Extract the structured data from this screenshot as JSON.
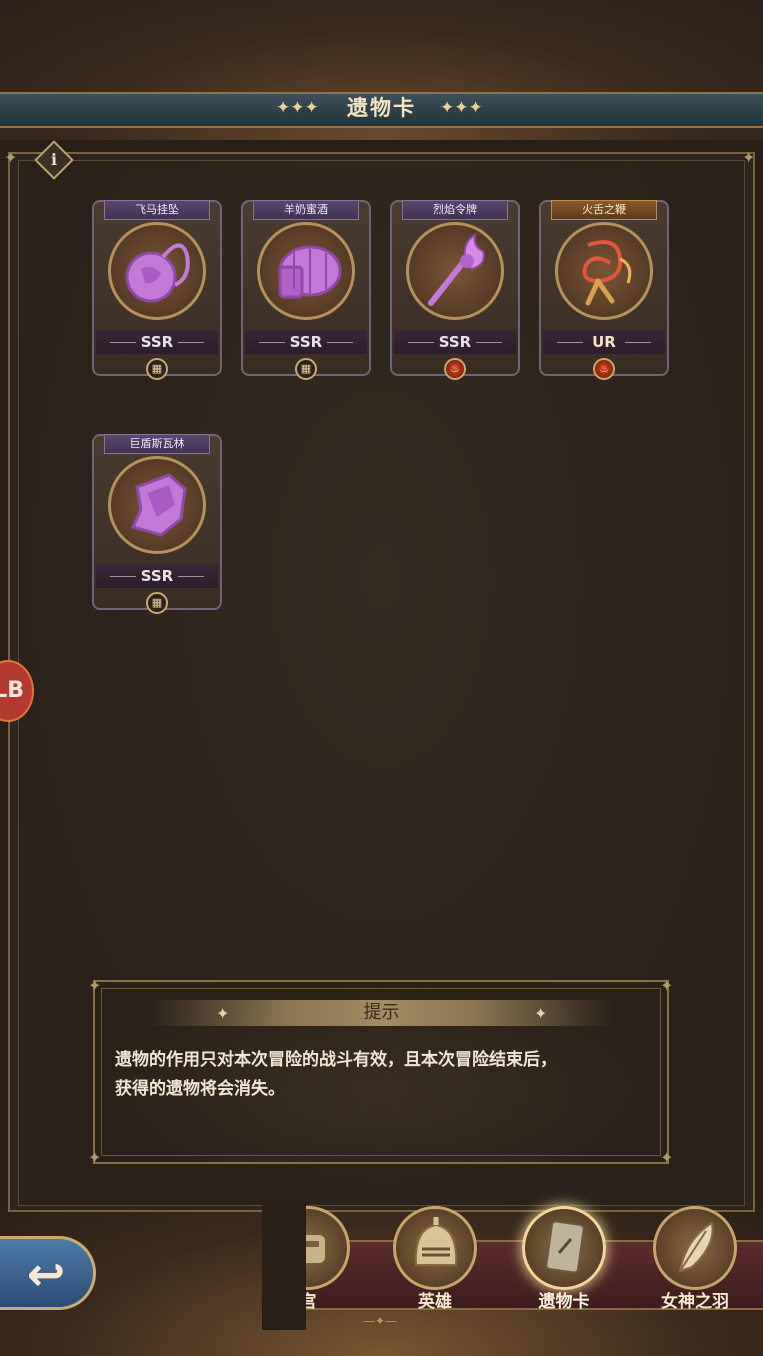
{
  "header": {
    "title": "遗物卡",
    "deco_left": "✦✦✦",
    "deco_right": "✦✦✦"
  },
  "info_button": {
    "glyph": "i"
  },
  "side_button": {
    "label": "LB"
  },
  "relics": [
    {
      "name": "飞马挂坠",
      "rarity": "SSR",
      "badge": "grid-icon",
      "color": "#c27ad8"
    },
    {
      "name": "羊奶蜜酒",
      "rarity": "SSR",
      "badge": "grid-icon",
      "color": "#c27ad8"
    },
    {
      "name": "烈焰令牌",
      "rarity": "SSR",
      "badge": "fire-icon",
      "color": "#c27ad8"
    },
    {
      "name": "火舌之鞭",
      "rarity": "UR",
      "badge": "fire-icon",
      "color": "#e2583a"
    },
    {
      "name": "巨盾斯瓦林",
      "rarity": "SSR",
      "badge": "grid-icon",
      "color": "#c27ad8"
    }
  ],
  "tip": {
    "title": "提示",
    "line1": "遗物的作用只对本次冒险的战斗有效，且本次冒险结束后，",
    "line2": "获得的遗物将会消失。"
  },
  "back_button": {
    "icon": "back-arrow-icon"
  },
  "bottom_nav": [
    {
      "label": "宫",
      "icon": "maze-icon"
    },
    {
      "label": "英雄",
      "icon": "helmet-icon"
    },
    {
      "label": "遗物卡",
      "icon": "card-icon",
      "active": true
    },
    {
      "label": "女神之羽",
      "icon": "feather-icon"
    }
  ],
  "colors": {
    "ssr_purple": "#c27ad8",
    "ur_orange": "#e2583a",
    "gold": "#c7a66a"
  }
}
